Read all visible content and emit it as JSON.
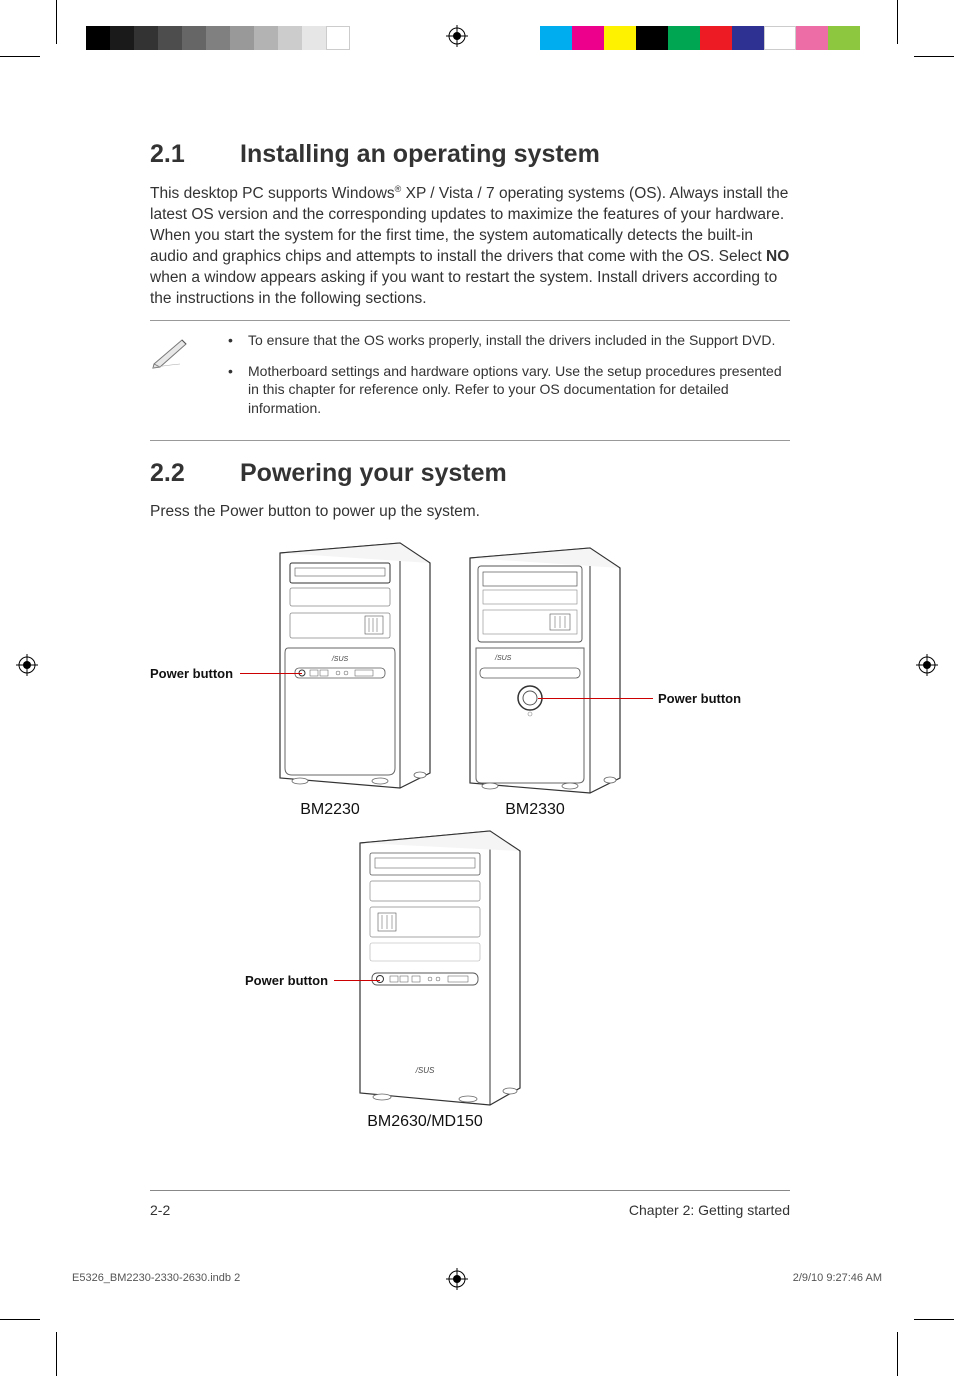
{
  "section1": {
    "number": "2.1",
    "title": "Installing an operating system",
    "body_pre": "This desktop PC supports Windows",
    "body_reg": "®",
    "body_mid": " XP / Vista / 7 operating systems (OS). Always install the latest OS version and the corresponding updates to maximize the features of your hardware. When you start the system for the first time, the system automatically detects the built-in audio and graphics chips and attempts to install the drivers that come with the OS. Select ",
    "body_bold": "NO",
    "body_post": " when a window appears asking if you want to restart the system. Install drivers according to the instructions in the following sections."
  },
  "notes": [
    "To ensure that the OS works properly, install the drivers included in the Support DVD.",
    "Motherboard settings and hardware options vary. Use the setup procedures presented in this chapter for reference only. Refer to your OS documentation for detailed information."
  ],
  "section2": {
    "number": "2.2",
    "title": "Powering your system",
    "body": "Press the Power button to power up the system."
  },
  "labels": {
    "power_button": "Power button",
    "model1": "BM2230",
    "model2": "BM2330",
    "model3": "BM2630/MD150"
  },
  "footer": {
    "page": "2-2",
    "chapter": "Chapter 2: Getting started"
  },
  "slug": {
    "file": "E5326_BM2230-2330-2630.indb   2",
    "datetime": "2/9/10   9:27:46 AM"
  },
  "colors": {
    "gray_bars": [
      "#000",
      "#1a1a1a",
      "#333",
      "#4d4d4d",
      "#666",
      "#808080",
      "#999",
      "#b3b3b3",
      "#ccc",
      "#e6e6e6",
      "#fff"
    ],
    "cmyk_bars": [
      "#00aeef",
      "#ec008c",
      "#fff200",
      "#000000",
      "#00a651",
      "#ed1c24",
      "#2e3192",
      "#fff",
      "#ed6ea6",
      "#8dc63f"
    ]
  }
}
